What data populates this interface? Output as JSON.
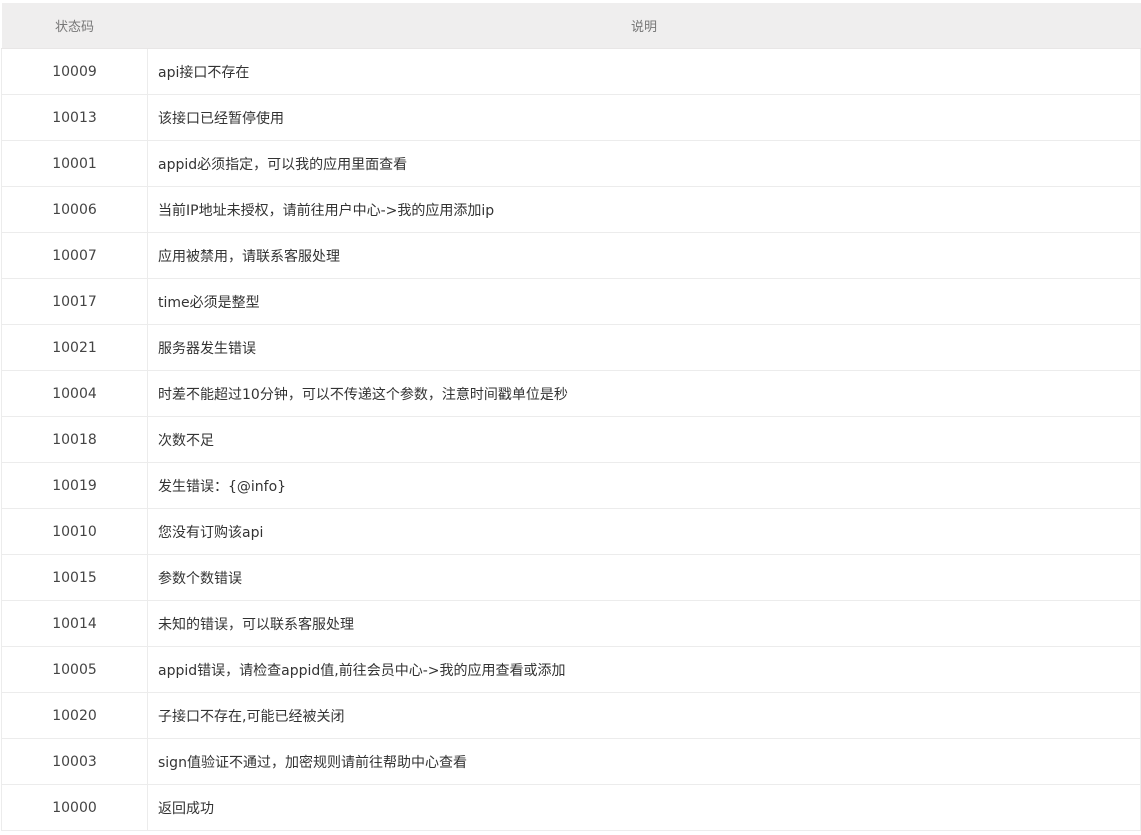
{
  "table": {
    "headers": {
      "code": "状态码",
      "description": "说明"
    },
    "rows": [
      {
        "code": "10009",
        "description": "api接口不存在"
      },
      {
        "code": "10013",
        "description": "该接口已经暂停使用"
      },
      {
        "code": "10001",
        "description": "appid必须指定，可以我的应用里面查看"
      },
      {
        "code": "10006",
        "description": "当前IP地址未授权，请前往用户中心->我的应用添加ip"
      },
      {
        "code": "10007",
        "description": "应用被禁用，请联系客服处理"
      },
      {
        "code": "10017",
        "description": "time必须是整型"
      },
      {
        "code": "10021",
        "description": "服务器发生错误"
      },
      {
        "code": "10004",
        "description": "时差不能超过10分钟，可以不传递这个参数，注意时间戳单位是秒"
      },
      {
        "code": "10018",
        "description": "次数不足"
      },
      {
        "code": "10019",
        "description": "发生错误：{@info}"
      },
      {
        "code": "10010",
        "description": "您没有订购该api"
      },
      {
        "code": "10015",
        "description": "参数个数错误"
      },
      {
        "code": "10014",
        "description": "未知的错误，可以联系客服处理"
      },
      {
        "code": "10005",
        "description": "appid错误，请检查appid值,前往会员中心->我的应用查看或添加"
      },
      {
        "code": "10020",
        "description": "子接口不存在,可能已经被关闭"
      },
      {
        "code": "10003",
        "description": "sign值验证不通过，加密规则请前往帮助中心查看"
      },
      {
        "code": "10000",
        "description": "返回成功"
      }
    ]
  }
}
